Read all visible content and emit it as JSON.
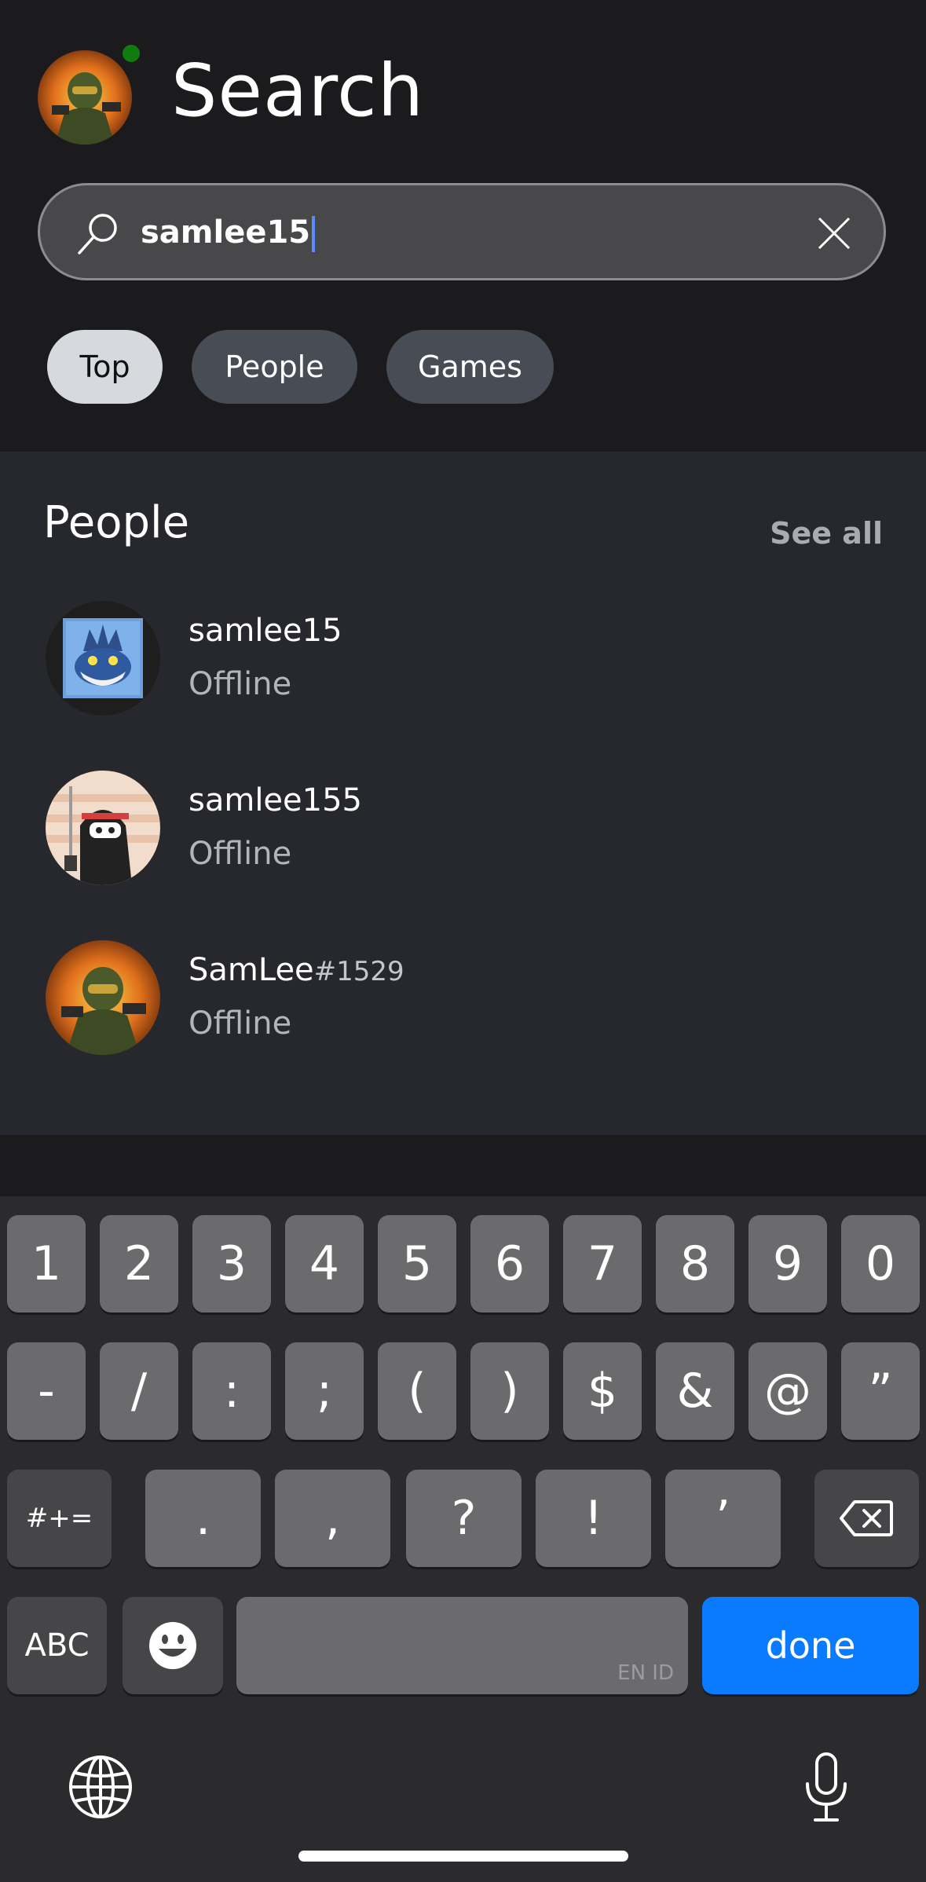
{
  "header": {
    "title": "Search",
    "avatar_icon": "profile-avatar-image",
    "presence_color": "#107c10"
  },
  "search": {
    "value": "samlee15",
    "icon": "search-icon",
    "clear_icon": "close-icon"
  },
  "filters": [
    {
      "label": "Top",
      "selected": true
    },
    {
      "label": "People",
      "selected": false
    },
    {
      "label": "Games",
      "selected": false
    }
  ],
  "people_section": {
    "title": "People",
    "see_all_label": "See all",
    "results": [
      {
        "name": "samlee15",
        "tag": "",
        "status": "Offline"
      },
      {
        "name": "samlee155",
        "tag": "",
        "status": "Offline"
      },
      {
        "name": "SamLee",
        "tag": "#1529",
        "status": "Offline"
      }
    ]
  },
  "keyboard": {
    "row1": [
      "1",
      "2",
      "3",
      "4",
      "5",
      "6",
      "7",
      "8",
      "9",
      "0"
    ],
    "row2": [
      "-",
      "/",
      ":",
      ";",
      "(",
      ")",
      "$",
      "&",
      "@",
      "”"
    ],
    "row3": [
      ".",
      ",",
      "?",
      "!",
      "’"
    ],
    "more_label": "#+=",
    "abc_label": "ABC",
    "lang_label": "EN ID",
    "done_label": "done",
    "accent_color": "#0a7bff"
  }
}
